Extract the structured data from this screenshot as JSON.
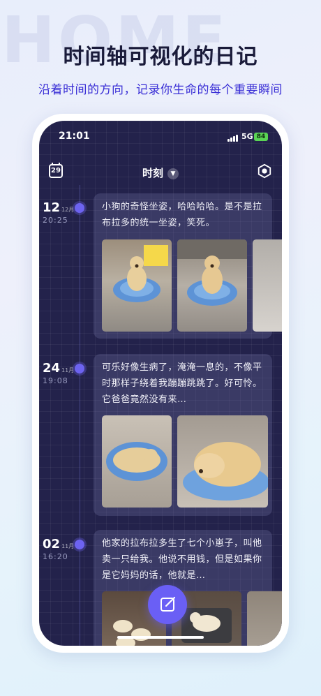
{
  "promo": {
    "bg_word": "HOME",
    "headline": "时间轴可视化的日记",
    "subline": "沿着时间的方向，记录你生命的每个重要瞬间"
  },
  "status_bar": {
    "time": "21:01",
    "network": "5G",
    "battery": "84"
  },
  "topbar": {
    "calendar_day": "29",
    "title": "时刻",
    "title_icon": "chevron-down-icon",
    "settings_icon": "hexagon-settings-icon"
  },
  "entries": [
    {
      "day": "12",
      "month": "12月",
      "time": "20:25",
      "text": "小狗的奇怪坐姿，哈哈哈哈。是不是拉布拉多的统一坐姿，笑死。",
      "photos": [
        "puppy sitting in blue bed",
        "puppy sitting in blue bed",
        "partial photo"
      ]
    },
    {
      "day": "24",
      "month": "11月",
      "time": "19:08",
      "text": "可乐好像生病了，淹淹一息的，不像平时那样子绕着我蹦蹦跳跳了。好可怜。它爸爸竟然没有来…",
      "photos": [
        "puppy sleeping curled in bed",
        "puppy sleeping close-up"
      ]
    },
    {
      "day": "02",
      "month": "11月",
      "time": "16:20",
      "text": "他家的拉布拉多生了七个小崽子，叫他卖一只给我。他说不用钱，但是如果你是它妈妈的话，他就是…",
      "photos": [
        "puppies in a box",
        "puppies on a mat",
        "partial photo"
      ]
    }
  ],
  "fab": {
    "icon": "edit-icon"
  },
  "colors": {
    "accent": "#6a5ff5",
    "screen_bg": "#23224b",
    "subline": "#3a2fd6"
  }
}
